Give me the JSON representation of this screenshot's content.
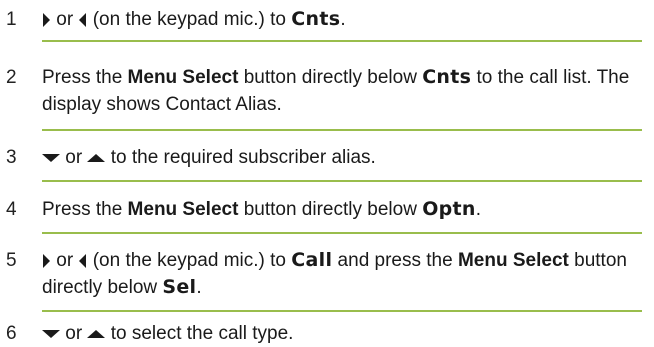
{
  "steps": [
    {
      "number": "1",
      "text": [
        {
          "icon": "right-arrow-icon"
        },
        {
          "t": " or "
        },
        {
          "icon": "left-arrow-icon"
        },
        {
          "t": " (on the keypad mic.) to "
        },
        {
          "t": "Cnts",
          "style": "mono"
        },
        {
          "t": "."
        }
      ]
    },
    {
      "number": "2",
      "text": [
        {
          "t": "Press the "
        },
        {
          "t": "Menu Select",
          "style": "b"
        },
        {
          "t": " button directly below "
        },
        {
          "t": "Cnts",
          "style": "mono"
        },
        {
          "t": " to the call list. The display shows Contact Alias."
        }
      ]
    },
    {
      "number": "3",
      "text": [
        {
          "icon": "down-arrow-icon"
        },
        {
          "t": " or "
        },
        {
          "icon": "up-arrow-icon"
        },
        {
          "t": " to the required subscriber alias."
        }
      ]
    },
    {
      "number": "4",
      "text": [
        {
          "t": "Press the "
        },
        {
          "t": "Menu Select",
          "style": "b"
        },
        {
          "t": " button directly below "
        },
        {
          "t": "Optn",
          "style": "mono"
        },
        {
          "t": "."
        }
      ]
    },
    {
      "number": "5",
      "text": [
        {
          "icon": "right-arrow-icon"
        },
        {
          "t": " or "
        },
        {
          "icon": "left-arrow-icon"
        },
        {
          "t": " (on the keypad mic.) to "
        },
        {
          "t": "Call",
          "style": "mono"
        },
        {
          "t": " and press the "
        },
        {
          "t": "Menu Select",
          "style": "b"
        },
        {
          "t": " button directly below "
        },
        {
          "t": "Sel",
          "style": "mono"
        },
        {
          "t": "."
        }
      ]
    },
    {
      "number": "6",
      "text": [
        {
          "icon": "down-arrow-icon"
        },
        {
          "t": " or "
        },
        {
          "icon": "up-arrow-icon"
        },
        {
          "t": " to select the call type."
        }
      ]
    }
  ],
  "colors": {
    "rule": "#99bd4c",
    "text": "#1a1a1a"
  }
}
